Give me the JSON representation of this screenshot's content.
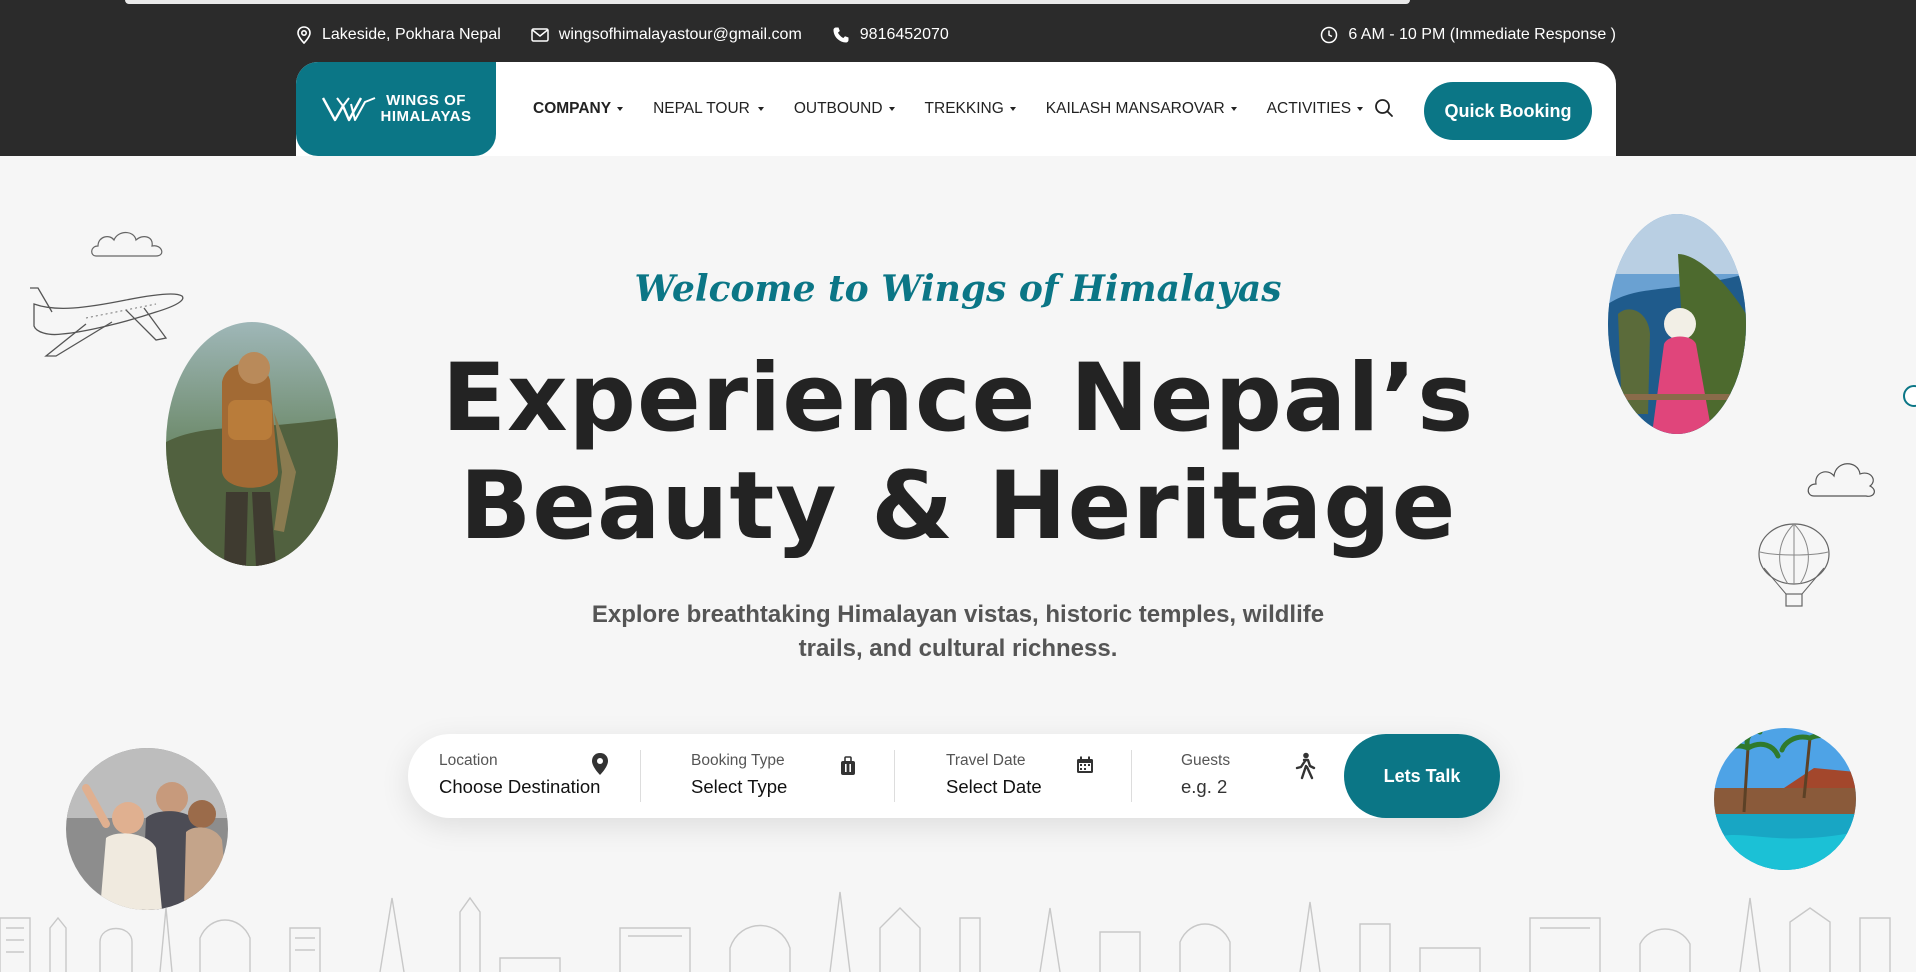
{
  "topbar": {
    "location": "Lakeside, Pokhara Nepal",
    "email": "wingsofhimalayastour@gmail.com",
    "phone": "9816452070",
    "hours": "6 AM - 10 PM (Immediate Response )"
  },
  "brand": {
    "line1": "WINGS OF",
    "line2": "HIMALAYAS",
    "color": "#0b7686"
  },
  "nav": {
    "items": [
      {
        "label": "COMPANY"
      },
      {
        "label": "NEPAL TOUR"
      },
      {
        "label": "OUTBOUND"
      },
      {
        "label": "TREKKING"
      },
      {
        "label": "KAILASH MANSAROVAR"
      },
      {
        "label": "ACTIVITIES"
      }
    ],
    "search_icon": "search-icon",
    "quick_booking": "Quick Booking"
  },
  "hero": {
    "welcome": "Welcome to Wings of Himalayas",
    "title_line1": "Experience Nepal’s",
    "title_line2": "Beauty & Heritage",
    "subtitle_line1": "Explore breathtaking Himalayan vistas, historic temples, wildlife",
    "subtitle_line2": "trails, and cultural richness."
  },
  "booking": {
    "location": {
      "label": "Location",
      "value": "Choose Destination",
      "icon": "map-pin-icon"
    },
    "type": {
      "label": "Booking Type",
      "value": "Select Type",
      "icon": "luggage-icon"
    },
    "date": {
      "label": "Travel Date",
      "value": "Select Date",
      "icon": "calendar-icon"
    },
    "guests": {
      "label": "Guests",
      "value": "e.g. 2",
      "icon": "walking-person-icon"
    },
    "submit": "Lets Talk"
  }
}
